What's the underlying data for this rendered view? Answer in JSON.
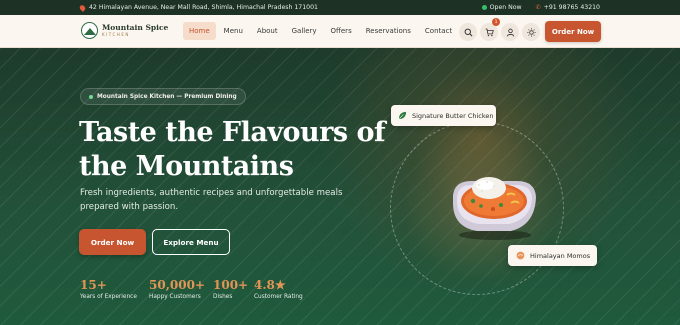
{
  "topbar": {
    "address": "42 Himalayan Avenue, Near Mall Road, Shimla, Himachal Pradesh 171001",
    "status": "Open Now",
    "phone": "+91 98765 43210"
  },
  "brand": {
    "name": "Mountain Spice",
    "sub": "KITCHEN"
  },
  "nav": {
    "links": [
      "Home",
      "Menu",
      "About",
      "Gallery",
      "Offers",
      "Reservations",
      "Contact"
    ],
    "active": "Home",
    "cart_count": "1",
    "order_label": "Order Now"
  },
  "hero": {
    "tag": "Mountain Spice Kitchen — Premium Dining",
    "title_line1": "Taste the Flavours of",
    "title_line2": "the Mountains",
    "subtitle": "Fresh ingredients, authentic recipes and unforgettable meals prepared with passion.",
    "cta_primary": "Order Now",
    "cta_secondary": "Explore Menu",
    "stats": [
      {
        "value": "15+",
        "label": "Years of Experience"
      },
      {
        "value": "50,000+",
        "label": "Happy Customers"
      },
      {
        "value": "100+",
        "label": "Dishes"
      },
      {
        "value": "4.8★",
        "label": "Customer Rating"
      }
    ],
    "card_top": "Signature Butter Chicken",
    "card_bottom": "Himalayan Momos"
  },
  "colors": {
    "accent": "#c65530",
    "stat_gold": "#e29556",
    "dark_green": "#1d3124"
  },
  "icons": [
    "pin-icon",
    "open-dot-icon",
    "phone-icon",
    "search-icon",
    "cart-icon",
    "user-icon",
    "sun-icon",
    "leaf-icon",
    "momo-icon"
  ]
}
